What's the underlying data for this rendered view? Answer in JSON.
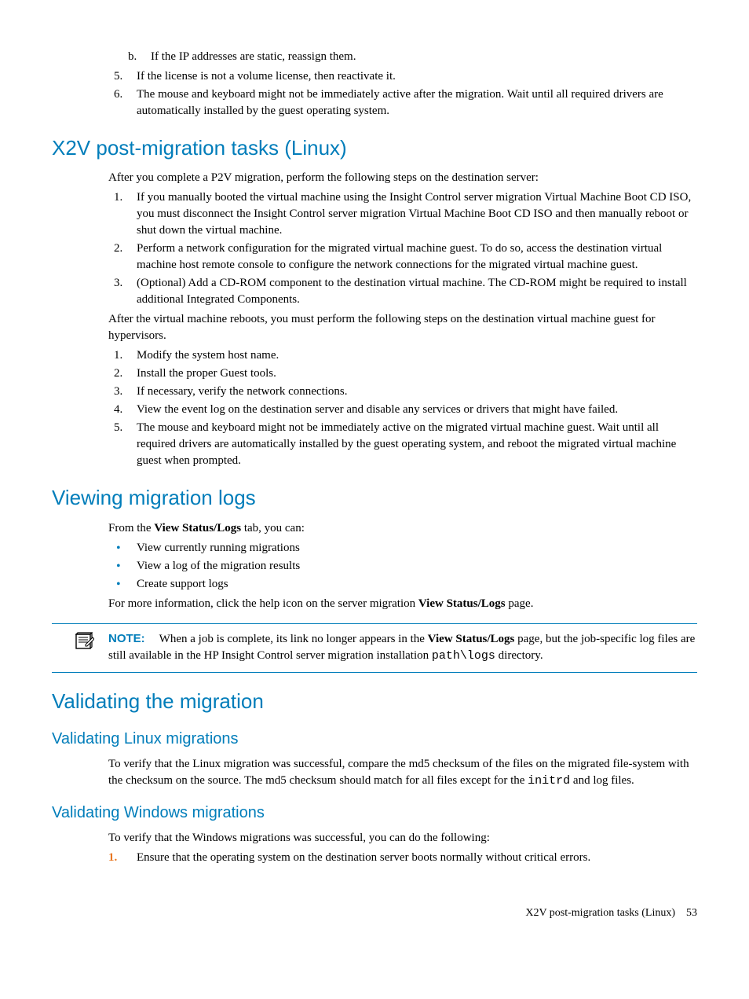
{
  "top_list": {
    "b": "If the IP addresses are static, reassign them.",
    "item5": "If the license is not a volume license, then reactivate it.",
    "item6": "The mouse and keyboard might not be immediately active after the migration. Wait until all required drivers are automatically installed by the guest operating system."
  },
  "h_x2v": "X2V post-migration tasks (Linux)",
  "x2v_intro": "After you complete a P2V migration, perform the following steps on the destination server:",
  "x2v_list": [
    "If you manually booted the virtual machine using the Insight Control server migration Virtual Machine Boot CD ISO, you must disconnect the Insight Control server migration Virtual Machine Boot CD ISO and then manually reboot or shut down the virtual machine.",
    "Perform a network configuration for the migrated virtual machine guest. To do so, access the destination virtual machine host remote console to configure the network connections for the migrated virtual machine guest.",
    "(Optional) Add a CD-ROM component to the destination virtual machine. The CD-ROM might be required to install additional Integrated Components."
  ],
  "x2v_after": "After the virtual machine reboots, you must perform the following steps on the destination virtual machine guest for hypervisors.",
  "x2v_list2": [
    "Modify the system host name.",
    "Install the proper Guest tools.",
    "If necessary, verify the network connections.",
    "View the event log on the destination server and disable any services or drivers that might have failed.",
    "The mouse and keyboard might not be immediately active on the migrated virtual machine guest. Wait until all required drivers are automatically installed by the guest operating system, and reboot the migrated virtual machine guest when prompted."
  ],
  "h_view": "Viewing migration logs",
  "view_intro_pre": "From the ",
  "view_intro_bold": "View Status/Logs",
  "view_intro_post": " tab, you can:",
  "view_bullets": [
    "View currently running migrations",
    "View a log of the migration results",
    "Create support logs"
  ],
  "view_more_pre": "For more information, click the help icon on the server migration ",
  "view_more_bold": "View Status/Logs",
  "view_more_post": " page.",
  "note_label": "NOTE:",
  "note_pre": "When a job is complete, its link no longer appears in the ",
  "note_bold": "View Status/Logs",
  "note_mid": " page, but the job-specific log files are still available in the HP Insight Control server migration installation ",
  "note_code": "path\\logs",
  "note_post": " directory.",
  "h_valid": "Validating the migration",
  "h_valid_linux": "Validating Linux migrations",
  "valid_linux_pre": "To verify that the Linux migration was successful, compare the md5 checksum of the files on the migrated file-system with the checksum on the source. The md5 checksum should match for all files except for the ",
  "valid_linux_code": "initrd",
  "valid_linux_post": " and log files.",
  "h_valid_win": "Validating Windows migrations",
  "valid_win_intro": "To verify that the Windows migrations was successful, you can do the following:",
  "valid_win_item1_marker": "1.",
  "valid_win_item1": "Ensure that the operating system on the destination server boots normally without critical errors.",
  "footer_title": "X2V post-migration tasks (Linux)",
  "footer_page": "53"
}
